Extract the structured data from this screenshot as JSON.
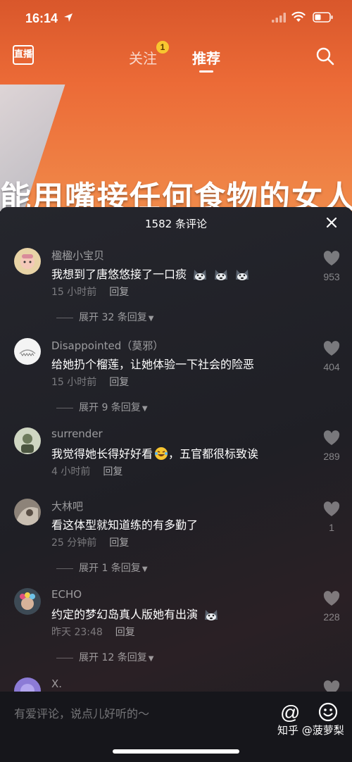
{
  "status_bar": {
    "time": "16:14"
  },
  "video": {
    "caption": "能用嘴接任何食物的女人"
  },
  "top_nav": {
    "live_label": "直播",
    "follow_label": "关注",
    "follow_badge": "1",
    "recommend_label": "推荐"
  },
  "comments_panel": {
    "title": "1582 条评论",
    "reply_label": "回复",
    "comments": [
      {
        "name": "楹楹小宝贝",
        "text": "我想到了唐悠悠接了一口痰",
        "emojis": 3,
        "time": "15 小时前",
        "likes": "953",
        "expand": "展开 32 条回复"
      },
      {
        "name": "Disappointed（莫邪）",
        "text": "给她扔个榴莲，让她体验一下社会的险恶",
        "time": "15 小时前",
        "likes": "404",
        "expand": "展开 9 条回复"
      },
      {
        "name": "surrender",
        "text_before": "我觉得她长得好好看",
        "text_after": "，五官都很标致诶",
        "time": "4 小时前",
        "likes": "289"
      },
      {
        "name": "大林吧",
        "text": "看这体型就知道练的有多勤了",
        "time": "25 分钟前",
        "likes": "1",
        "expand": "展开 1 条回复"
      },
      {
        "name": "ECHO",
        "text": "约定的梦幻岛真人版她有出演",
        "time": "昨天 23:48",
        "likes": "228",
        "expand": "展开 12 条回复"
      },
      {
        "name": "X."
      }
    ]
  },
  "input_bar": {
    "placeholder": "有爱评论，说点儿好听的～",
    "at_symbol": "@"
  },
  "watermark": "知乎 @菠萝梨",
  "colors": {
    "accent_badge": "#f8c630",
    "video_orange": "#ec6b37",
    "sheet_bg": "#1f1f25"
  }
}
